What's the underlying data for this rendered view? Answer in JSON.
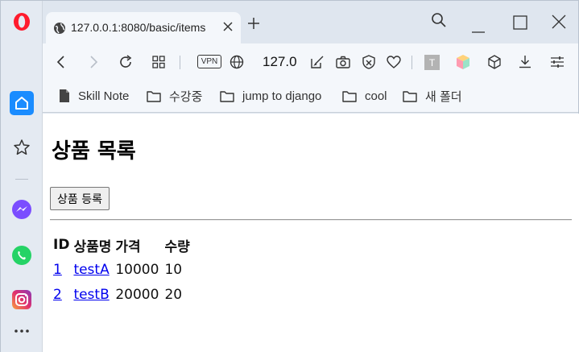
{
  "browser": {
    "tab": {
      "title": "127.0.0.1:8080/basic/items"
    },
    "address": "127.0.0.1:8080/basic/items",
    "address_display": "127.0",
    "vpn_label": "VPN",
    "extension_badge": "T"
  },
  "bookmarks": [
    {
      "label": "Skill Note",
      "icon": "page-icon"
    },
    {
      "label": "수강중",
      "icon": "folder-icon"
    },
    {
      "label": "jump to django",
      "icon": "folder-icon"
    },
    {
      "label": "cool",
      "icon": "folder-icon"
    },
    {
      "label": "새 폴더",
      "icon": "folder-icon"
    }
  ],
  "sidebar": {
    "items": [
      "opera-logo",
      "home-icon",
      "star-icon",
      "messenger-icon",
      "whatsapp-icon",
      "instagram-icon",
      "more-icon"
    ]
  },
  "page": {
    "title": "상품 목록",
    "register_button": "상품 등록",
    "table": {
      "headers": [
        "ID",
        "상품명",
        "가격",
        "수량"
      ],
      "rows": [
        {
          "id": "1",
          "name": "testA",
          "price": "10000",
          "quantity": "10"
        },
        {
          "id": "2",
          "name": "testB",
          "price": "20000",
          "quantity": "20"
        }
      ]
    }
  },
  "colors": {
    "chrome_bg": "#dfe6ef",
    "toolbar_bg": "#f4f7fb",
    "link": "#0000ee",
    "opera_red": "#ff1b2d"
  }
}
